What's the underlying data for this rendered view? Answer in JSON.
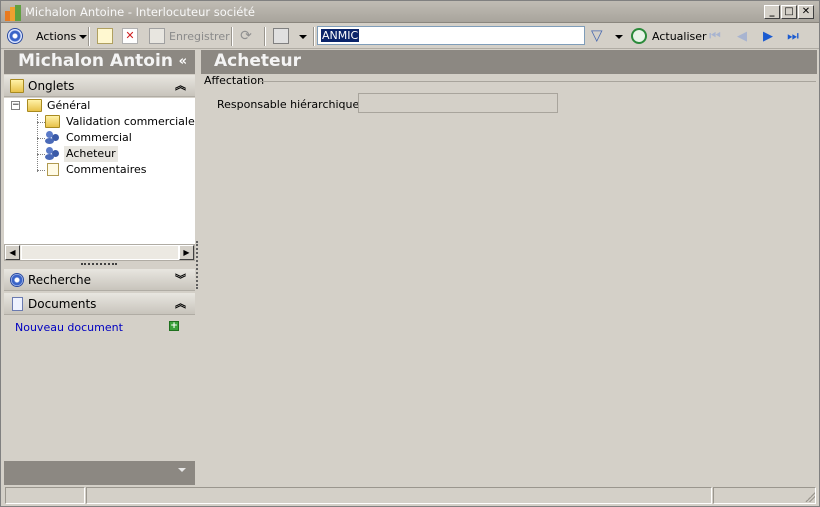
{
  "window": {
    "title": "Michalon Antoine - Interlocuteur société",
    "minimize": "_",
    "maximize": "□",
    "close": "✕"
  },
  "toolbar": {
    "actions_label": "Actions",
    "save_label": "Enregistrer",
    "search_value": "ANMIC",
    "refresh_label": "Actualiser",
    "first_icon": "⏮",
    "prev_icon": "◀",
    "next_icon": "▶",
    "last_icon": "⏭"
  },
  "left_panel": {
    "contact_name": "Michalon Antoine",
    "collapse_icon": "«",
    "tabs_section": {
      "label": "Onglets",
      "chevron": "︽"
    },
    "tree": [
      {
        "label": "Général",
        "icon": "folder-icon",
        "expander": "−"
      },
      {
        "label": "Validation commerciale / BA",
        "icon": "folder-icon"
      },
      {
        "label": "Commercial",
        "icon": "people-icon"
      },
      {
        "label": "Acheteur",
        "icon": "people-icon",
        "selected": true
      },
      {
        "label": "Commentaires",
        "icon": "document-icon"
      }
    ],
    "search_section": {
      "label": "Recherche",
      "chevron": "︾"
    },
    "documents_section": {
      "label": "Documents",
      "chevron": "︽",
      "new_document": "Nouveau document",
      "add_icon": "+"
    }
  },
  "main": {
    "title": "Acheteur",
    "group_title": "Affectation",
    "fields": [
      {
        "label": "Responsable hiérarchique :",
        "value": ""
      }
    ]
  },
  "colors": {
    "header_bg": "#8c8882",
    "window_bg": "#d4d0c8",
    "link": "#0000c0",
    "search_highlight": "#0a246a"
  }
}
